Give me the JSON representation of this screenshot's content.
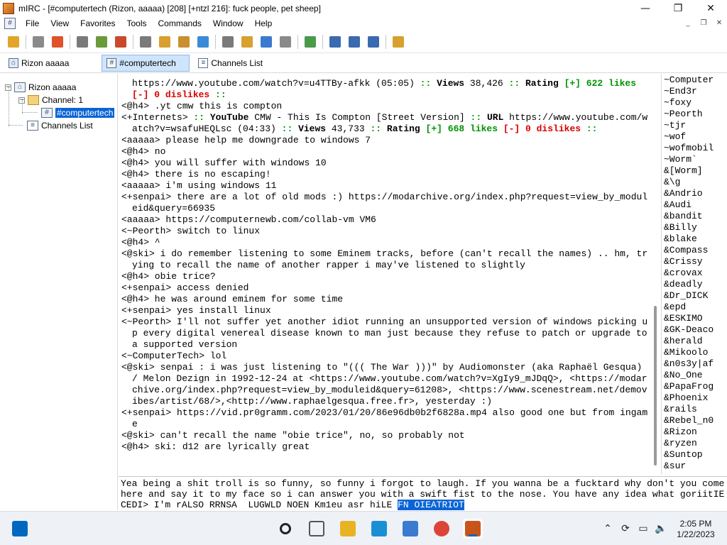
{
  "window": {
    "title": "mIRC - [#computertech (Rizon, aaaaa) [208] [+ntzl 216]: fuck people, pet sheep]",
    "minimize_glyph": "—",
    "maximize_glyph": "❐",
    "close_glyph": "✕"
  },
  "menu": {
    "doc_glyph": "#",
    "items": [
      "File",
      "View",
      "Favorites",
      "Tools",
      "Commands",
      "Window",
      "Help"
    ],
    "mdi_minimize": "_",
    "mdi_restore": "❐",
    "mdi_close": "✕"
  },
  "toolbar": {
    "buttons": [
      {
        "name": "connect-icon",
        "color": "#e0a52a"
      },
      {
        "name": "options-icon",
        "color": "#8a8a8a"
      },
      {
        "name": "favorites-icon",
        "color": "#e0522a"
      },
      {
        "name": "channel-list-icon",
        "color": "#7a7a7a"
      },
      {
        "name": "scripts-editor-icon",
        "color": "#6a9a3a"
      },
      {
        "name": "address-book-icon",
        "color": "#c84a2a"
      },
      {
        "name": "timer-icon",
        "color": "#7a7a7a"
      },
      {
        "name": "colors-icon",
        "color": "#d8a030"
      },
      {
        "name": "dcc-send-icon",
        "color": "#c89030"
      },
      {
        "name": "dcc-chat-icon",
        "color": "#3a8ad8"
      },
      {
        "name": "online-timer-icon",
        "color": "#7a7a7a"
      },
      {
        "name": "notify-icon",
        "color": "#d8a030"
      },
      {
        "name": "url-list-icon",
        "color": "#3a7ad0"
      },
      {
        "name": "received-files-icon",
        "color": "#8a8a8a"
      },
      {
        "name": "logs-icon",
        "color": "#4a9a4a"
      },
      {
        "name": "tile-horizontal-icon",
        "color": "#3a6ab0"
      },
      {
        "name": "tile-vertical-icon",
        "color": "#3a6ab0"
      },
      {
        "name": "cascade-icon",
        "color": "#3a6ab0"
      },
      {
        "name": "help-icon",
        "color": "#d8a030"
      }
    ]
  },
  "switchbar": {
    "items": [
      {
        "label": "Rizon aaaaa",
        "icon": "server-icon",
        "glyph": "⌂",
        "active": false
      },
      {
        "label": "#computertech",
        "icon": "channel-icon",
        "glyph": "#",
        "active": true
      },
      {
        "label": "Channels List",
        "icon": "list-icon",
        "glyph": "≡",
        "active": false
      }
    ]
  },
  "tree": {
    "server": {
      "label": "Rizon aaaaa",
      "toggle": "−",
      "glyph": "⌂"
    },
    "folder": {
      "label": "Channel: 1",
      "toggle": "−"
    },
    "channel": {
      "label": "#computertech",
      "glyph": "#"
    },
    "channels_list": {
      "label": "Channels List",
      "glyph": "≡"
    }
  },
  "chat": {
    "lines": [
      {
        "segs": [
          {
            "t": "https://www.youtube.com/watch?v=u4TTBy-afkk (05:05) "
          },
          {
            "t": "::",
            "c": "g"
          },
          {
            "t": " "
          },
          {
            "t": "Views",
            "c": "b"
          },
          {
            "t": " 38,426 "
          },
          {
            "t": "::",
            "c": "g"
          },
          {
            "t": " "
          },
          {
            "t": "Rating",
            "c": "b"
          },
          {
            "t": " "
          },
          {
            "t": "[+]",
            "c": "g"
          },
          {
            "t": " "
          },
          {
            "t": "622",
            "c": "g"
          },
          {
            "t": " "
          },
          {
            "t": "likes",
            "c": "g"
          },
          {
            "t": " "
          },
          {
            "t": "[-]",
            "c": "r"
          },
          {
            "t": " "
          },
          {
            "t": "0 dislikes",
            "c": "r"
          },
          {
            "t": " "
          },
          {
            "t": "::",
            "c": "g"
          }
        ],
        "cont": true
      },
      {
        "segs": [
          {
            "t": "<@h4> .yt cmw this is compton"
          }
        ]
      },
      {
        "segs": [
          {
            "t": "<+Internets> "
          },
          {
            "t": "::",
            "c": "g"
          },
          {
            "t": " "
          },
          {
            "t": "YouTube",
            "c": "b"
          },
          {
            "t": " CMW - This Is Compton [Street Version] "
          },
          {
            "t": "::",
            "c": "g"
          },
          {
            "t": " "
          },
          {
            "t": "URL",
            "c": "b"
          },
          {
            "t": " https://www.youtube.com/watch?v=wsafuHEQLsc (04:33) "
          },
          {
            "t": "::",
            "c": "g"
          },
          {
            "t": " "
          },
          {
            "t": "Views",
            "c": "b"
          },
          {
            "t": " 43,733 "
          },
          {
            "t": "::",
            "c": "g"
          },
          {
            "t": " "
          },
          {
            "t": "Rating",
            "c": "b"
          },
          {
            "t": " "
          },
          {
            "t": "[+]",
            "c": "g"
          },
          {
            "t": " "
          },
          {
            "t": "668",
            "c": "g"
          },
          {
            "t": " "
          },
          {
            "t": "likes",
            "c": "g"
          },
          {
            "t": " "
          },
          {
            "t": "[-]",
            "c": "r"
          },
          {
            "t": " "
          },
          {
            "t": "0 dislikes",
            "c": "r"
          },
          {
            "t": " "
          },
          {
            "t": "::",
            "c": "g"
          }
        ]
      },
      {
        "segs": [
          {
            "t": "<aaaaa> please help me downgrade to windows 7"
          }
        ]
      },
      {
        "segs": [
          {
            "t": "<@h4> no"
          }
        ]
      },
      {
        "segs": [
          {
            "t": "<@h4> you will suffer with windows 10"
          }
        ]
      },
      {
        "segs": [
          {
            "t": "<@h4> there is no escaping!"
          }
        ]
      },
      {
        "segs": [
          {
            "t": "<aaaaa> i'm using windows 11"
          }
        ]
      },
      {
        "segs": [
          {
            "t": "<+senpai> there are a lot of old mods :) https://modarchive.org/index.php?request=view_by_moduleid&query=66935"
          }
        ]
      },
      {
        "segs": [
          {
            "t": "<aaaaa> https://computernewb.com/collab-vm VM6"
          }
        ]
      },
      {
        "segs": [
          {
            "t": "<~Peorth> switch to linux"
          }
        ]
      },
      {
        "segs": [
          {
            "t": "<@h4> ^"
          }
        ]
      },
      {
        "segs": [
          {
            "t": "<@ski> i do remember listening to some Eminem tracks, before (can't recall the names) .. hm, trying to recall the name of another rapper i may've listened to slightly"
          }
        ]
      },
      {
        "segs": [
          {
            "t": "<@h4> obie trice?"
          }
        ]
      },
      {
        "segs": [
          {
            "t": "<+senpai> access denied"
          }
        ]
      },
      {
        "segs": [
          {
            "t": "<@h4> he was around eminem for some time"
          }
        ]
      },
      {
        "segs": [
          {
            "t": "<+senpai> yes install linux"
          }
        ]
      },
      {
        "segs": [
          {
            "t": "<~Peorth> I'll not suffer yet another idiot running an unsupported version of windows picking up every digital venereal disease known to man just because they refuse to patch or upgrade to a supported version"
          }
        ]
      },
      {
        "segs": [
          {
            "t": "<~ComputerTech> lol"
          }
        ]
      },
      {
        "segs": [
          {
            "t": "<@ski> senpai : i was just listening to \"((( The War )))\" by Audiomonster (aka Raphaël Gesqua) / Melon Dezign in 1992-12-24 at <https://www.youtube.com/watch?v=XgIy9_mJDqQ>, <https://modarchive.org/index.php?request=view_by_moduleid&query=61208>, <https://www.scenestream.net/demovibes/artist/68/>,<http://www.raphaelgesqua.free.fr>, yesterday :)"
          }
        ]
      },
      {
        "segs": [
          {
            "t": "<+senpai> https://vid.pr0gramm.com/2023/01/20/86e96db0b2f6828a.mp4 also good one but from ingame"
          }
        ]
      },
      {
        "segs": [
          {
            "t": "<@ski> can't recall the name \"obie trice\", no, so probably not"
          }
        ]
      },
      {
        "segs": [
          {
            "t": "<@h4> ski: d12 are lyrically great"
          }
        ]
      }
    ]
  },
  "nicklist": {
    "nicks": [
      "~Computer",
      "~End3r",
      "~foxy",
      "~Peorth",
      "~tjr",
      "~wof",
      "~wofmobil",
      "~Worm`",
      "&[Worm]",
      "&\\g",
      "&Andrio",
      "&Audi",
      "&bandit",
      "&Billy",
      "&blake",
      "&Compass",
      "&Crissy",
      "&crovax",
      "&deadly",
      "&Dr_DICK",
      "&epd",
      "&ESKIMO",
      "&GK-Deaco",
      "&herald",
      "&Mikoolo",
      "&n0s3y|af",
      "&No_One",
      "&PapaFrog",
      "&Phoenix",
      "&rails",
      "&Rebel_n0",
      "&Rizon",
      "&ryzen",
      "&Suntop",
      "&sur"
    ]
  },
  "editbox": {
    "text": "Yea being a shit troll is so funny, so funny i forgot to laugh. If you wanna be a fucktard why don't you come here and say it to my face so i can answer you with a swift fist to the nose. You have any idea what goriitIECEDI> I'm rALSO RRNSA  LUGWLD NOEN Km1eu asr hiLE ",
    "selected": "FN OIEATRIOT"
  },
  "taskbar": {
    "apps": [
      {
        "name": "start-icon",
        "color": "#0067c0"
      },
      {
        "name": "search-icon",
        "color": "#222222"
      },
      {
        "name": "task-view-icon",
        "color": "#555555"
      },
      {
        "name": "file-explorer-icon",
        "color": "#e8b323"
      },
      {
        "name": "edge-icon",
        "color": "#1a8fd6"
      },
      {
        "name": "store-icon",
        "color": "#3a7ad0"
      },
      {
        "name": "chrome-icon",
        "color": "#db4437"
      },
      {
        "name": "mirc-icon",
        "color": "#c8541a"
      }
    ],
    "tray": {
      "chevron": "⌃",
      "sync": "⟳",
      "monitor": "▭",
      "volume": "🔈"
    },
    "time": "2:05 PM",
    "date": "1/22/2023"
  }
}
